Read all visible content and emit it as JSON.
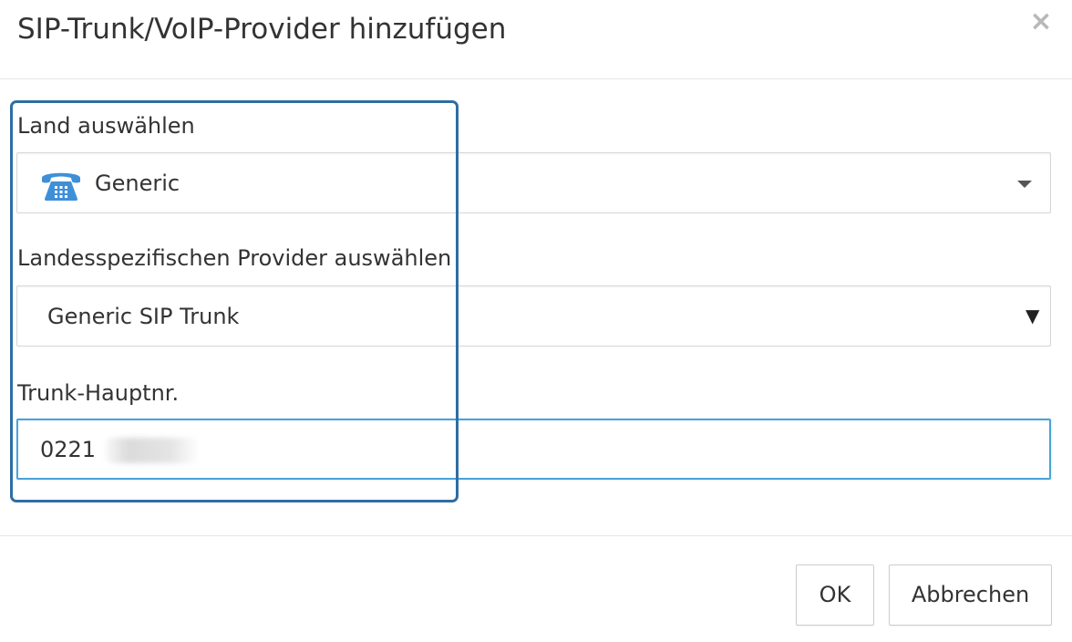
{
  "dialog": {
    "title": "SIP-Trunk/VoIP-Provider hinzufügen",
    "close_icon": "×"
  },
  "form": {
    "country": {
      "label": "Land auswählen",
      "value": "Generic",
      "icon": "telephone-icon",
      "icon_color": "#3f8fd8"
    },
    "provider": {
      "label": "Landesspezifischen Provider auswählen",
      "value": "Generic SIP Trunk",
      "arrow": "▼"
    },
    "trunk_number": {
      "label": "Trunk-Hauptnr.",
      "value": "0221"
    }
  },
  "footer": {
    "ok_label": "OK",
    "cancel_label": "Abbrechen"
  },
  "colors": {
    "highlight_border": "#2e6da4",
    "focus_border": "#4aa3d8"
  }
}
